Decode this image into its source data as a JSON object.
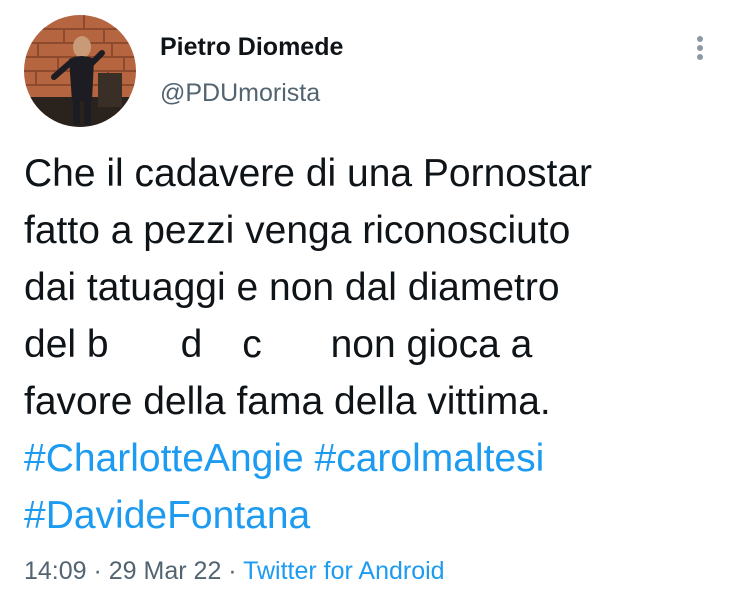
{
  "author": {
    "display_name": "Pietro Diomede",
    "handle": "@PDUmorista",
    "avatar_icon": "profile-photo"
  },
  "more_icon": "more-vertical-icon",
  "tweet": {
    "lines": [
      [
        "Che il cadavere di una Pornostar"
      ],
      [
        "fatto a pezzi venga riconosciuto"
      ],
      [
        "dai tatuaggi e non dal diametro"
      ],
      [
        "del b",
        "d",
        "c",
        " non gioca a"
      ],
      [
        "favore della fama della vittima."
      ]
    ],
    "hashtags": [
      "#CharlotteAngie",
      "#carolmaltesi",
      "#DavideFontana"
    ]
  },
  "meta": {
    "time": "14:09",
    "separator": " · ",
    "date": "29 Mar 22",
    "source": "Twitter for Android"
  },
  "colors": {
    "text": "#0f1419",
    "secondary": "#536471",
    "link": "#1d9bf0"
  }
}
